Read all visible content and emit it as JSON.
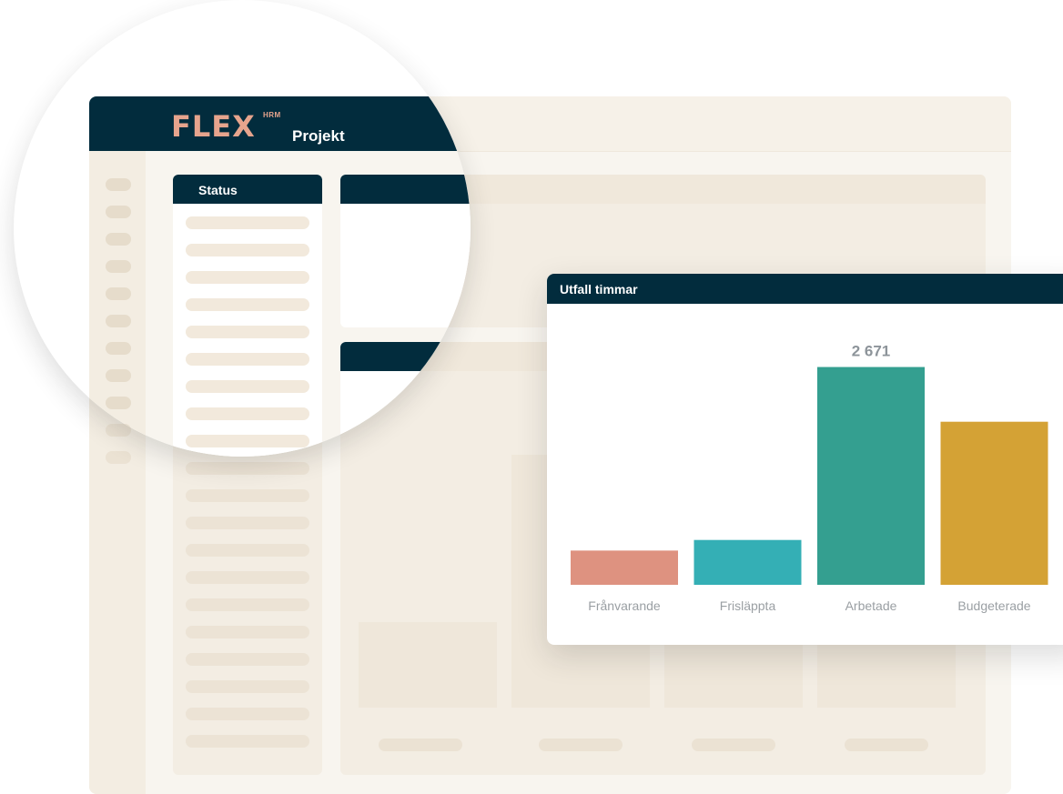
{
  "app": {
    "logo": "FLEX",
    "logo_sup": "HRM",
    "title": "Projekt"
  },
  "status_panel": {
    "title": "Status",
    "row_count": 20
  },
  "chart_card": {
    "title": "Utfall timmar"
  },
  "chart_data": {
    "type": "bar",
    "categories": [
      "Frånvarande",
      "Frisläppta",
      "Arbetade",
      "Budgeterade"
    ],
    "values": [
      420,
      550,
      2671,
      2000
    ],
    "data_labels": [
      "",
      "",
      "2 671",
      ""
    ],
    "colors": [
      "#de9280",
      "#34afb5",
      "#349f90",
      "#d4a235"
    ],
    "ylim": [
      0,
      2900
    ],
    "grid": false,
    "legend": "none"
  },
  "colors": {
    "header": "#022c3d",
    "accent_logo": "#e6a48d",
    "background": "#f8f5ef"
  }
}
